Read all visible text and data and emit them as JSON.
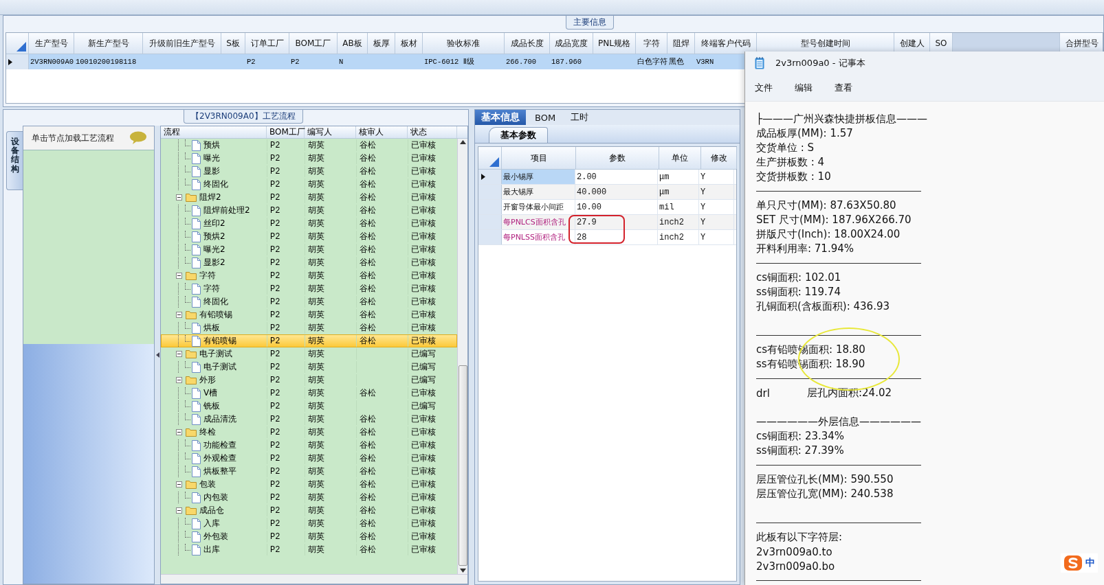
{
  "main_info": {
    "title": "主要信息",
    "columns": [
      "生产型号",
      "新生产型号",
      "升级前旧生产型号",
      "S板",
      "订单工厂",
      "BOM工厂",
      "AB板",
      "板厚",
      "板材",
      "验收标准",
      "成品长度",
      "成品宽度",
      "PNL规格",
      "字符",
      "阻焊",
      "终端客户代码",
      "型号创建时间",
      "创建人",
      "SO",
      "合拼型号"
    ],
    "rows": [
      {
        "selected": true,
        "cells": [
          {
            "text": "2V3RN009A0"
          },
          {
            "text": "10010200198118"
          },
          {},
          {},
          {
            "text": "P2"
          },
          {
            "text": "P2"
          },
          {
            "text": "N"
          },
          {},
          {},
          {
            "text": "IPC-6012 Ⅱ级"
          },
          {
            "text": "266.700"
          },
          {
            "text": "187.960"
          },
          {},
          {
            "text": "白色字符"
          },
          {
            "text": "黑色"
          },
          {
            "text": "V3RN"
          }
        ]
      }
    ]
  },
  "side_panel": {
    "tab": "设备结构",
    "hint": "单击节点加载工艺流程"
  },
  "process_tree": {
    "title": "【2V3RN009A0】工艺流程",
    "columns": [
      "流程",
      "BOM工厂",
      "编写人",
      "核审人",
      "状态"
    ],
    "nodes": [
      {
        "children": [
          {
            "label": "预烘",
            "bom": "P2",
            "writer": "胡英",
            "reviewer": "谷松",
            "status": "已审核",
            "selected": false
          },
          {
            "label": "曝光",
            "bom": "P2",
            "writer": "胡英",
            "reviewer": "谷松",
            "status": "已审核",
            "selected": false
          },
          {
            "label": "显影",
            "bom": "P2",
            "writer": "胡英",
            "reviewer": "谷松",
            "status": "已审核",
            "selected": false
          },
          {
            "label": "终固化",
            "bom": "P2",
            "writer": "胡英",
            "reviewer": "谷松",
            "status": "已审核",
            "selected": false
          }
        ]
      },
      {
        "label": "阻焊2",
        "bom": "P2",
        "writer": "胡英",
        "reviewer": "谷松",
        "status": "已审核",
        "selected": false,
        "expanded": true,
        "children": [
          {
            "label": "阻焊前处理2",
            "bom": "P2",
            "writer": "胡英",
            "reviewer": "谷松",
            "status": "已审核",
            "selected": false
          },
          {
            "label": "丝印2",
            "bom": "P2",
            "writer": "胡英",
            "reviewer": "谷松",
            "status": "已审核",
            "selected": false
          },
          {
            "label": "预烘2",
            "bom": "P2",
            "writer": "胡英",
            "reviewer": "谷松",
            "status": "已审核",
            "selected": false
          },
          {
            "label": "曝光2",
            "bom": "P2",
            "writer": "胡英",
            "reviewer": "谷松",
            "status": "已审核",
            "selected": false
          },
          {
            "label": "显影2",
            "bom": "P2",
            "writer": "胡英",
            "reviewer": "谷松",
            "status": "已审核",
            "selected": false
          }
        ]
      },
      {
        "label": "字符",
        "bom": "P2",
        "writer": "胡英",
        "reviewer": "谷松",
        "status": "已审核",
        "selected": false,
        "expanded": true,
        "children": [
          {
            "label": "字符",
            "bom": "P2",
            "writer": "胡英",
            "reviewer": "谷松",
            "status": "已审核",
            "selected": false
          },
          {
            "label": "终固化",
            "bom": "P2",
            "writer": "胡英",
            "reviewer": "谷松",
            "status": "已审核",
            "selected": false
          }
        ]
      },
      {
        "label": "有铅喷锡",
        "bom": "P2",
        "writer": "胡英",
        "reviewer": "谷松",
        "status": "已审核",
        "selected": false,
        "expanded": true,
        "children": [
          {
            "label": "烘板",
            "bom": "P2",
            "writer": "胡英",
            "reviewer": "谷松",
            "status": "已审核",
            "selected": false
          },
          {
            "label": "有铅喷锡",
            "bom": "P2",
            "writer": "胡英",
            "reviewer": "谷松",
            "status": "已审核",
            "selected": true
          }
        ]
      },
      {
        "label": "电子测试",
        "bom": "P2",
        "writer": "胡英",
        "status": "已编写",
        "selected": false,
        "expanded": true,
        "children": [
          {
            "label": "电子测试",
            "bom": "P2",
            "writer": "胡英",
            "status": "已编写",
            "selected": false
          }
        ]
      },
      {
        "label": "外形",
        "bom": "P2",
        "writer": "胡英",
        "status": "已编写",
        "selected": false,
        "expanded": true,
        "children": [
          {
            "label": "V槽",
            "bom": "P2",
            "writer": "胡英",
            "reviewer": "谷松",
            "status": "已审核",
            "selected": false
          },
          {
            "label": "铣板",
            "bom": "P2",
            "writer": "胡英",
            "status": "已编写",
            "selected": false
          },
          {
            "label": "成品清洗",
            "bom": "P2",
            "writer": "胡英",
            "reviewer": "谷松",
            "status": "已审核",
            "selected": false
          }
        ]
      },
      {
        "label": "终检",
        "bom": "P2",
        "writer": "胡英",
        "reviewer": "谷松",
        "status": "已审核",
        "selected": false,
        "expanded": true,
        "children": [
          {
            "label": "功能检查",
            "bom": "P2",
            "writer": "胡英",
            "reviewer": "谷松",
            "status": "已审核",
            "selected": false
          },
          {
            "label": "外观检查",
            "bom": "P2",
            "writer": "胡英",
            "reviewer": "谷松",
            "status": "已审核",
            "selected": false
          },
          {
            "label": "烘板整平",
            "bom": "P2",
            "writer": "胡英",
            "reviewer": "谷松",
            "status": "已审核",
            "selected": false
          }
        ]
      },
      {
        "label": "包装",
        "bom": "P2",
        "writer": "胡英",
        "reviewer": "谷松",
        "status": "已审核",
        "selected": false,
        "expanded": true,
        "children": [
          {
            "label": "内包装",
            "bom": "P2",
            "writer": "胡英",
            "reviewer": "谷松",
            "status": "已审核",
            "selected": false
          }
        ]
      },
      {
        "label": "成品仓",
        "bom": "P2",
        "writer": "胡英",
        "reviewer": "谷松",
        "status": "已审核",
        "selected": false,
        "expanded": true,
        "children": [
          {
            "label": "入库",
            "bom": "P2",
            "writer": "胡英",
            "reviewer": "谷松",
            "status": "已审核",
            "selected": false
          },
          {
            "label": "外包装",
            "bom": "P2",
            "writer": "胡英",
            "reviewer": "谷松",
            "status": "已审核",
            "selected": false
          },
          {
            "label": "出库",
            "bom": "P2",
            "writer": "胡英",
            "reviewer": "谷松",
            "status": "已审核",
            "selected": false
          }
        ]
      }
    ]
  },
  "detail_panel": {
    "tabs": [
      {
        "label": "基本信息",
        "selected": true
      },
      {
        "label": "BOM",
        "selected": false
      },
      {
        "label": "工时",
        "selected": false
      }
    ],
    "subtabs": [
      {
        "label": "基本参数",
        "selected": true
      }
    ],
    "columns": [
      "项目",
      "参数",
      "单位",
      "修改"
    ],
    "rows": [
      {
        "item": "最小锡厚",
        "value": "2.00",
        "unit": "μm",
        "modify": "Y",
        "selected": true,
        "flagged": false
      },
      {
        "item": "最大锡厚",
        "value": "40.000",
        "unit": "μm",
        "modify": "Y",
        "selected": false,
        "flagged": false
      },
      {
        "item": "开窗导体最小间距",
        "value": "10.00",
        "unit": "mil",
        "modify": "Y",
        "selected": false,
        "flagged": false
      },
      {
        "item": "每PNLCS面积含孔",
        "value": "27.9",
        "unit": "inch2",
        "modify": "Y",
        "selected": false,
        "flagged": true
      },
      {
        "item": "每PNLSS面积含孔",
        "value": "28",
        "unit": "inch2",
        "modify": "Y",
        "selected": false,
        "flagged": true
      }
    ]
  },
  "notepad": {
    "title": "2v3rn009a0 - 记事本",
    "menu": [
      "文件",
      "编辑",
      "查看"
    ],
    "lines": [
      {
        "kind": "text",
        "text": "├———广州兴森快捷拼板信息———"
      },
      {
        "kind": "text",
        "text": "成品板厚(MM): 1.57"
      },
      {
        "kind": "text",
        "text": "交货单位 : S"
      },
      {
        "kind": "text",
        "text": "生产拼板数 : 4"
      },
      {
        "kind": "text",
        "text": "交货拼板数 : 10"
      },
      {
        "kind": "rule"
      },
      {
        "kind": "text",
        "text": "单只尺寸(MM): 87.63X50.80"
      },
      {
        "kind": "text",
        "text": "SET 尺寸(MM): 187.96X266.70"
      },
      {
        "kind": "text",
        "text": "拼版尺寸(Inch): 18.00X24.00"
      },
      {
        "kind": "text",
        "text": "开料利用率: 71.94%"
      },
      {
        "kind": "rule"
      },
      {
        "kind": "text",
        "text": "cs铜面积: 102.01"
      },
      {
        "kind": "text",
        "text": "ss铜面积: 119.74"
      },
      {
        "kind": "text",
        "text": "孔铜面积(含板面积): 436.93"
      },
      {
        "kind": "blank"
      },
      {
        "kind": "rule"
      },
      {
        "kind": "text",
        "text": "cs有铅喷锡面积: 18.80"
      },
      {
        "kind": "text",
        "text": "ss有铅喷锡面积: 18.90"
      },
      {
        "kind": "rule"
      },
      {
        "kind": "split",
        "left": "drl",
        "right": "层孔内面积:24.02"
      },
      {
        "kind": "blank"
      },
      {
        "kind": "text",
        "text": "——————外层信息——————"
      },
      {
        "kind": "text",
        "text": "cs铜面积: 23.34%"
      },
      {
        "kind": "text",
        "text": "ss铜面积: 27.39%"
      },
      {
        "kind": "rule"
      },
      {
        "kind": "text",
        "text": "层压管位孔长(MM): 590.550"
      },
      {
        "kind": "text",
        "text": "层压管位孔宽(MM): 240.538"
      },
      {
        "kind": "blank"
      },
      {
        "kind": "rule"
      },
      {
        "kind": "text",
        "text": "此板有以下字符层:"
      },
      {
        "kind": "text",
        "text": "2v3rn009a0.to"
      },
      {
        "kind": "text",
        "text": "2v3rn009a0.bo"
      },
      {
        "kind": "rule"
      }
    ]
  },
  "ime": {
    "mode": "中"
  }
}
